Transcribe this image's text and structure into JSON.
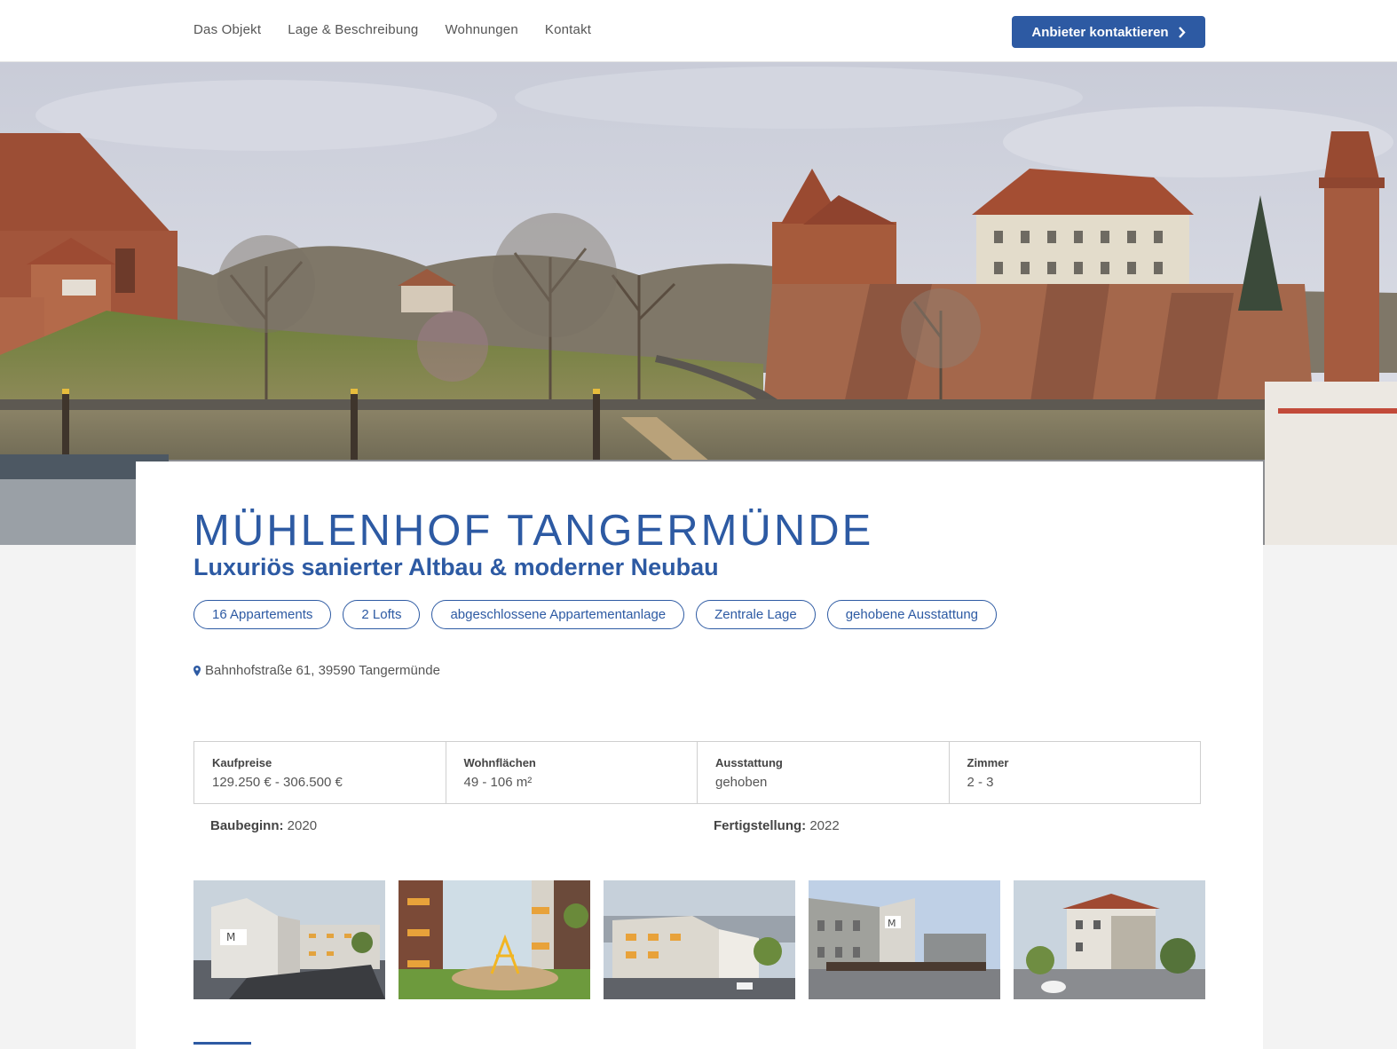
{
  "nav": {
    "items": [
      "Das Objekt",
      "Lage & Beschreibung",
      "Wohnungen",
      "Kontakt"
    ],
    "cta_label": "Anbieter kontaktieren"
  },
  "property": {
    "title": "MÜHLENHOF TANGERMÜNDE",
    "subtitle": "Luxuriös sanierter Altbau & moderner Neubau",
    "tags": [
      "16 Appartements",
      "2 Lofts",
      "abgeschlossene Appartementanlage",
      "Zentrale Lage",
      "gehobene Ausstattung"
    ],
    "address": "Bahnhofstraße 61, 39590 Tangermünde"
  },
  "facts": [
    {
      "label": "Kaufpreise",
      "value": "129.250 € - 306.500 €"
    },
    {
      "label": "Wohnflächen",
      "value": "49 - 106 m²"
    },
    {
      "label": "Ausstattung",
      "value": "gehoben"
    },
    {
      "label": "Zimmer",
      "value": "2 - 3"
    }
  ],
  "meta": {
    "start_label": "Baubeginn:",
    "start_value": "2020",
    "finish_label": "Fertigstellung:",
    "finish_value": "2022"
  },
  "colors": {
    "accent": "#2d5aa3",
    "background": "#f3f3f3",
    "card": "#ffffff"
  },
  "icons": {
    "cta": "chevron-right-icon",
    "address": "map-pin-icon"
  }
}
